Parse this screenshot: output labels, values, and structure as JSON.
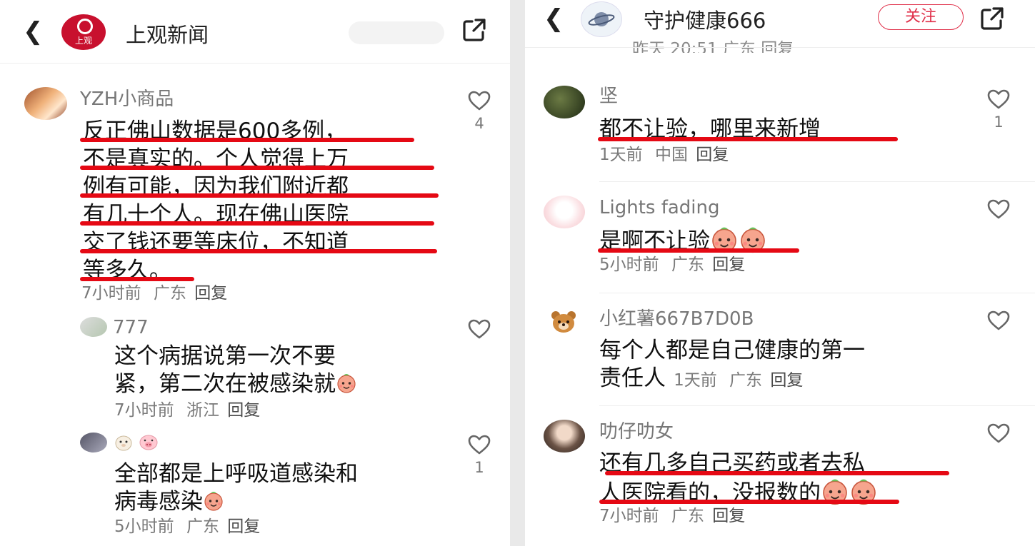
{
  "left": {
    "header": {
      "title": "上观新闻",
      "logo_text": "上观"
    },
    "comments": [
      {
        "user": "YZH小商品",
        "lines": [
          "反正佛山数据是600多例，",
          "不是真实的。个人觉得上万",
          "例有可能，因为我们附近都",
          "有几十个人。现在佛山医院",
          "交了钱还要等床位，不知道",
          "等多久。"
        ],
        "meta": {
          "time": "7小时前",
          "location": "广东",
          "reply": "回复"
        },
        "likes": "4"
      },
      {
        "user": "777",
        "lines": [
          "这个病据说第一次不要",
          "紧，第二次在被感染就"
        ],
        "meta": {
          "time": "7小时前",
          "location": "浙江",
          "reply": "回复"
        },
        "likes": ""
      },
      {
        "user": "",
        "lines": [
          "全部都是上呼吸道感染和",
          "病毒感染"
        ],
        "meta": {
          "time": "5小时前",
          "location": "广东",
          "reply": "回复"
        },
        "likes": "1"
      }
    ]
  },
  "right": {
    "header": {
      "title": "守护健康666",
      "follow_label": "关注"
    },
    "partial_meta": "昨天 20:51 广东 回复",
    "comments": [
      {
        "user": "坚",
        "lines": [
          "都不让验，哪里来新增"
        ],
        "meta": {
          "time": "1天前",
          "location": "中国",
          "reply": "回复"
        },
        "likes": "1"
      },
      {
        "user": "Lights fading",
        "lines": [
          "是啊不让验"
        ],
        "meta": {
          "time": "5小时前",
          "location": "广东",
          "reply": "回复"
        },
        "likes": ""
      },
      {
        "user": "小红薯667B7D0B",
        "lines": [
          "每个人都是自己健康的第一",
          "责任人"
        ],
        "meta": {
          "time": "1天前",
          "location": "广东",
          "reply": "回复"
        },
        "likes": ""
      },
      {
        "user": "叻仔叻女",
        "lines": [
          "还有几多自己买药或者去私",
          "人医院看的，没报数的"
        ],
        "meta": {
          "time": "7小时前",
          "location": "广东",
          "reply": "回复"
        },
        "likes": ""
      }
    ]
  },
  "colors": {
    "highlight": "#e50914",
    "follow": "#e0304a"
  },
  "icons": [
    "back-icon",
    "share-icon",
    "heart-icon",
    "emoji-icon"
  ]
}
